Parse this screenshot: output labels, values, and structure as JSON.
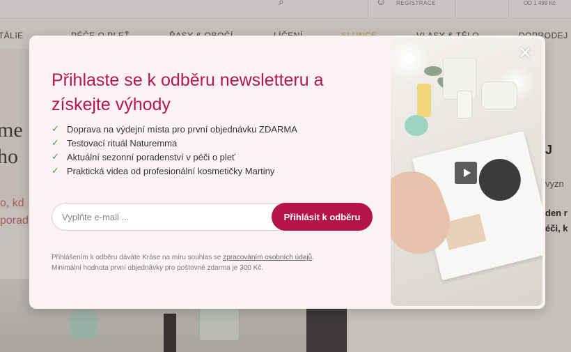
{
  "header": {
    "registration_label": "REGISTRACE",
    "shipping_label": "OD 1 499 Kč"
  },
  "nav": {
    "items": [
      "ITÁLIE",
      "PÉČE O PLEŤ",
      "ŘASY & OBOČÍ",
      "LÍČENÍ",
      "SLUNCE",
      "VLASY & TĚLO",
      "DOPRODEJ"
    ],
    "active_index": 4
  },
  "background": {
    "left_big_1": "me",
    "left_big_2": "ho",
    "left_pink_1": "o, kd",
    "left_pink_2": "porad",
    "right_text_1": "J",
    "right_text_2": "vyzn",
    "right_bold_1": "den r",
    "right_bold_2": "éči, k"
  },
  "modal": {
    "title": "Přihlaste se k odběru newsletteru a získejte výhody",
    "benefits": [
      "Doprava na výdejní místa pro první objednávku ZDARMA",
      "Testovací rituál Naturemma",
      "Aktuální sezonní poradenství v péči o pleť",
      "Praktická videa od profesionální kosmetičky Martiny"
    ],
    "email_placeholder": "Vyplňte e-mail ...",
    "email_value": "",
    "subscribe_label": "Přihlásit k odběru",
    "legal_prefix": "Přihlášením k odběru dáváte Kráse na míru souhlas se ",
    "legal_link": "zpracováním osobních údajů",
    "legal_suffix": ".",
    "legal_line2": "Minimální hodnota první objednávky pro poštovné zdarma je 300 Kč.",
    "close_symbol": "✕"
  },
  "icons": {
    "check": "✓",
    "search": "⌕",
    "user": "☺"
  },
  "colors": {
    "accent": "#b5134a",
    "title": "#b8174e",
    "check": "#2f9e45",
    "nav_active": "#e9b04b",
    "modal_bg": "#fdf3f4"
  }
}
